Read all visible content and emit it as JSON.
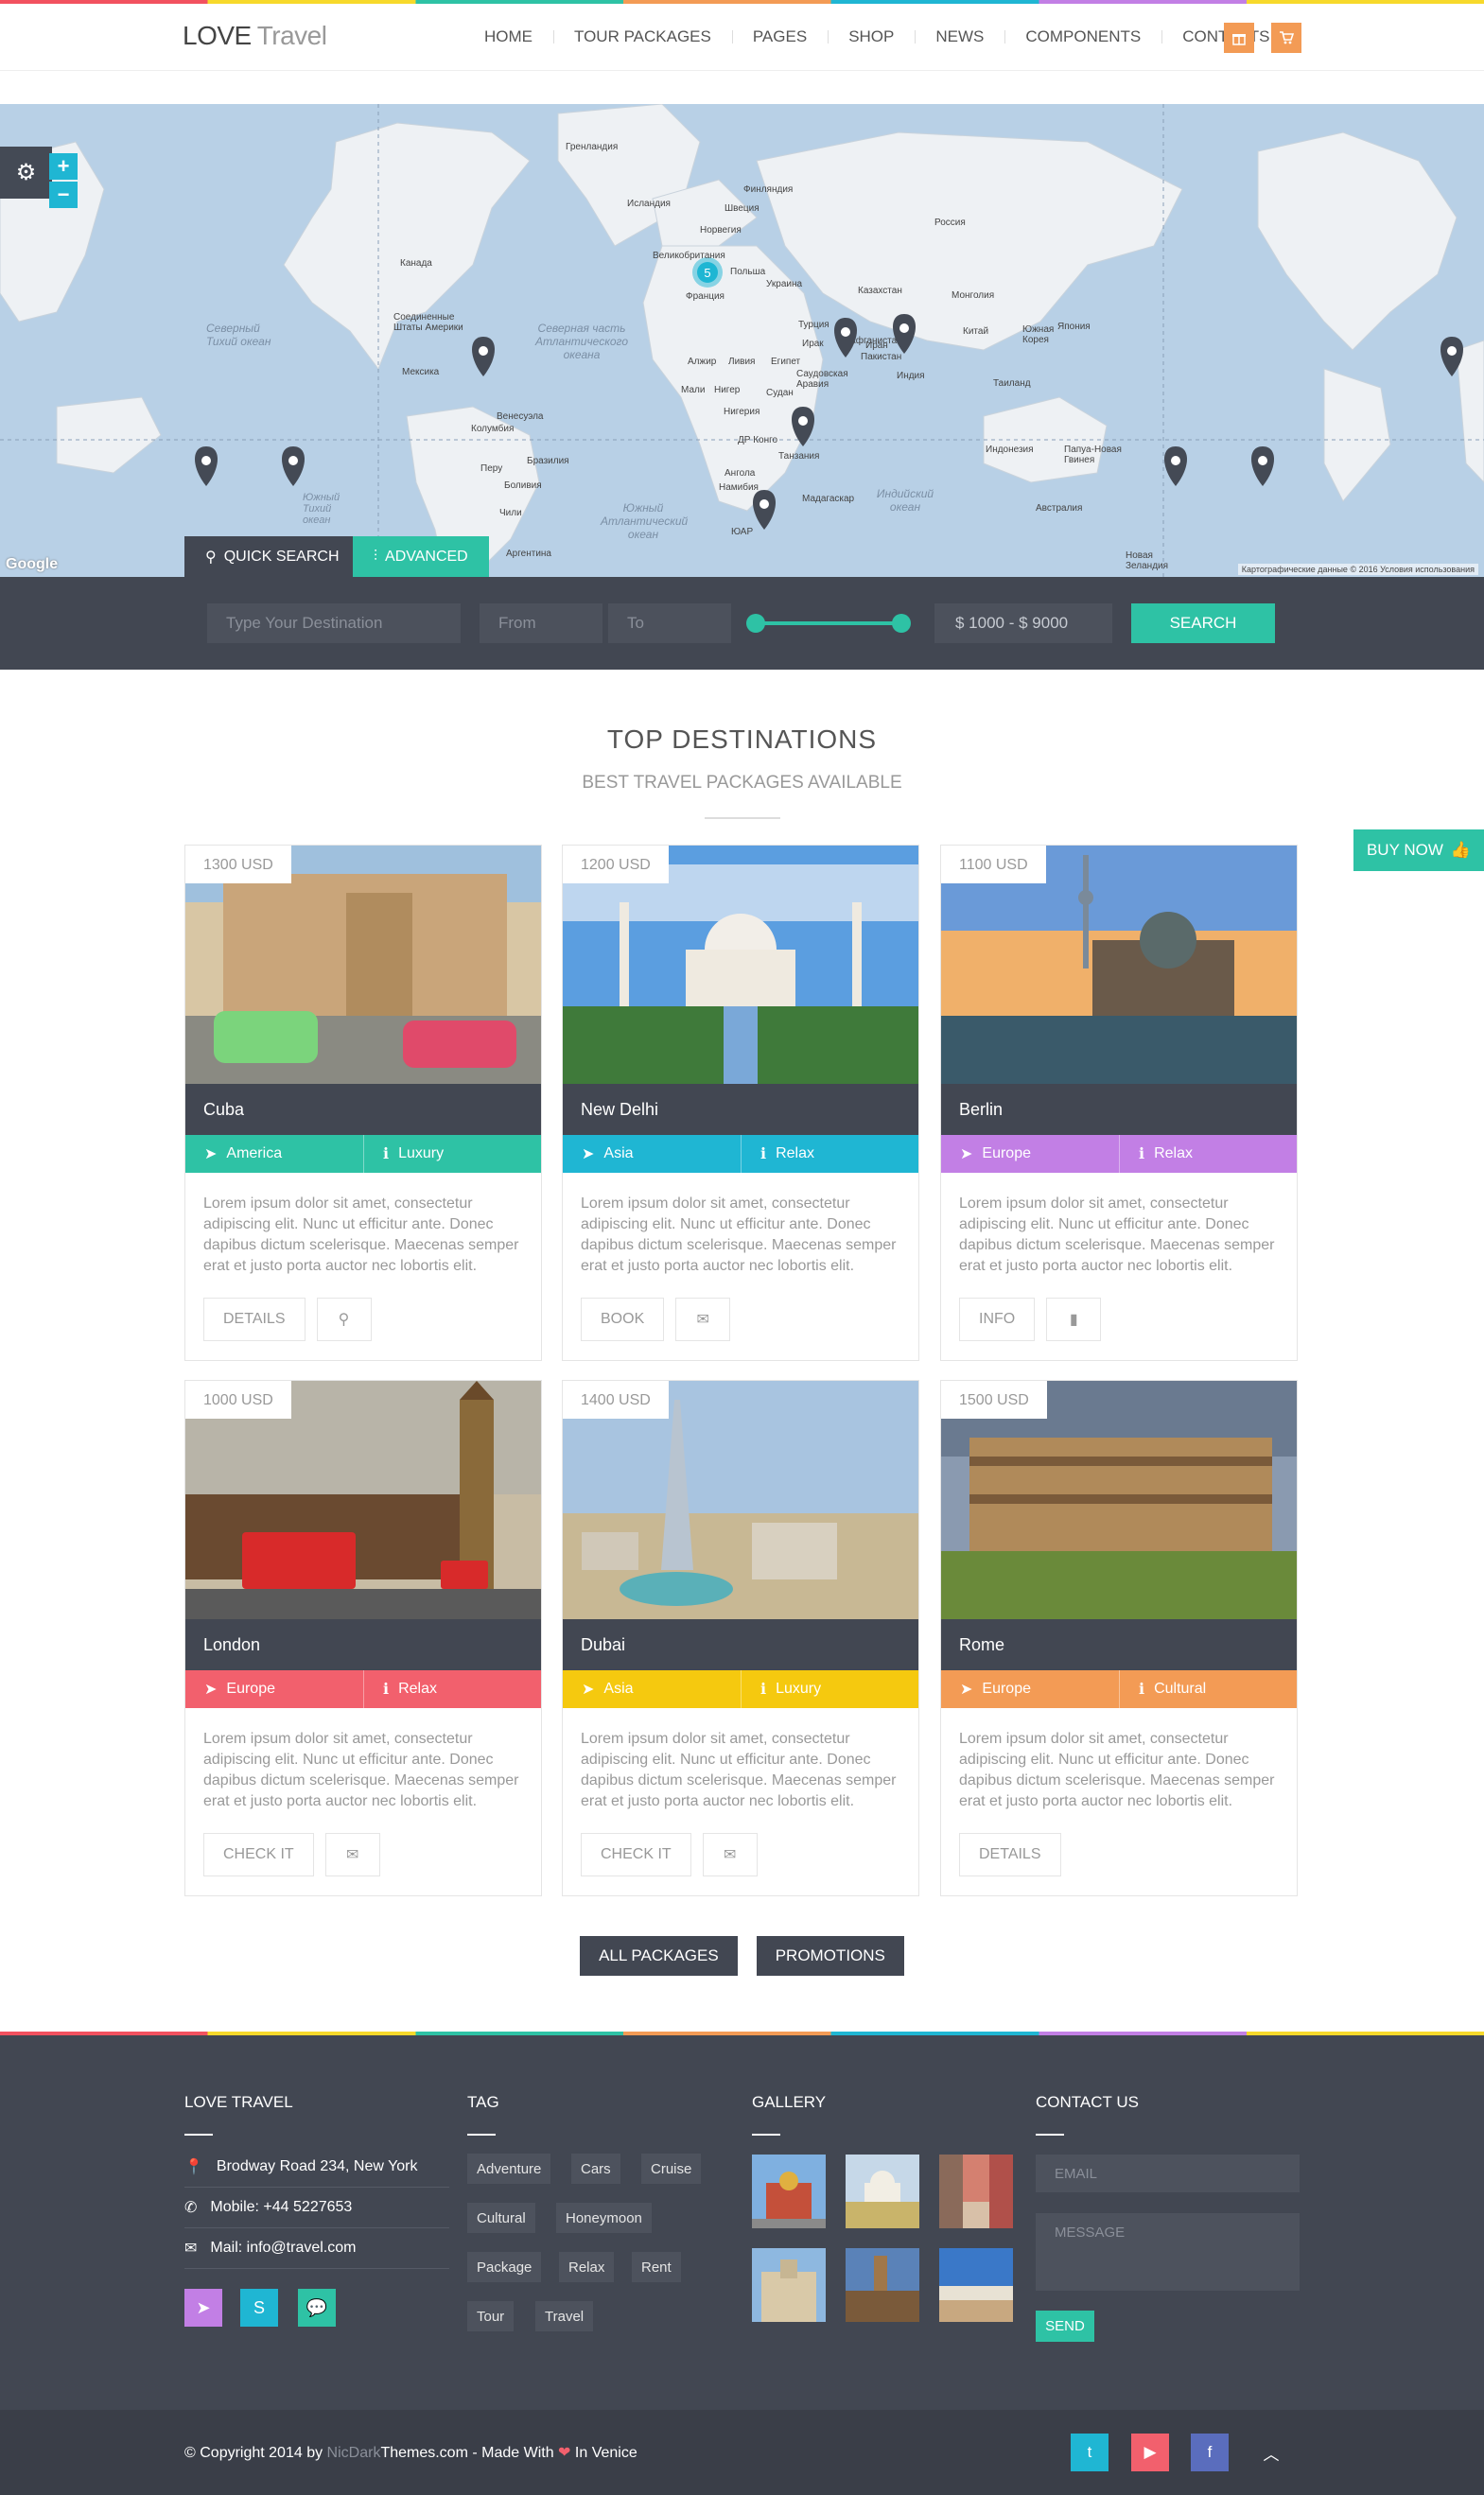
{
  "header": {
    "logo_bold": "LOVE",
    "logo_light": "Travel",
    "nav": [
      "HOME",
      "TOUR PACKAGES",
      "PAGES",
      "SHOP",
      "NEWS",
      "COMPONENTS",
      "CONTACTS"
    ],
    "icons": [
      "gift-icon",
      "cart-icon"
    ]
  },
  "map": {
    "zoom_in": "+",
    "zoom_out": "−",
    "cluster_count": "5",
    "google": "Google",
    "copyright": "Картографические данные © 2016   Условия использования",
    "labels": [
      "Гренландия",
      "Исландия",
      "Швеция",
      "Финляндия",
      "Норвегия",
      "Россия",
      "Великобритания",
      "Польша",
      "Украина",
      "Франция",
      "Казахстан",
      "Монголия",
      "Канада",
      "Соединенные Штаты Америки",
      "Мексика",
      "Венесуэла",
      "Колумбия",
      "Перу",
      "Бразилия",
      "Боливия",
      "Чили",
      "Аргентина",
      "Алжир",
      "Ливия",
      "Египет",
      "Мали",
      "Нигер",
      "Судан",
      "Нигерия",
      "ДР Конго",
      "Танзания",
      "Ангола",
      "Намибия",
      "ЮАР",
      "Мадагаскар",
      "Турция",
      "Ирак",
      "Иран",
      "Пакистан",
      "Индия",
      "Китай",
      "Япония",
      "Таиланд",
      "Индонезия",
      "Австралия",
      "Папуа-Новая Гвинея",
      "Новая Зеландия",
      "Северный Тихий океан",
      "Южный Тихий океан",
      "Северная часть Атлантического океана",
      "Южный Атлантический океан",
      "Индийский океан",
      "Саудовская Аравия",
      "Афганистан",
      "Южная Корея"
    ]
  },
  "search": {
    "tab_quick": "QUICK SEARCH",
    "tab_advanced": "ADVANCED",
    "destination_placeholder": "Type Your Destination",
    "from_placeholder": "From",
    "to_placeholder": "To",
    "price_range": "$ 1000 - $ 9000",
    "button": "SEARCH"
  },
  "section": {
    "title": "TOP DESTINATIONS",
    "subtitle": "BEST TRAVEL PACKAGES AVAILABLE"
  },
  "buy_now": "BUY NOW",
  "cards": [
    {
      "price": "1300 USD",
      "name": "Cuba",
      "tag1": "America",
      "tag2": "Luxury",
      "color": "#2ec2a5",
      "desc": "Lorem ipsum dolor sit amet, consectetur adipiscing elit. Nunc ut efficitur ante. Donec dapibus dictum scelerisque. Maecenas semper erat et justo porta auctor nec lobortis elit.",
      "btn": "DETAILS",
      "icon": "map-marker-icon"
    },
    {
      "price": "1200 USD",
      "name": "New Delhi",
      "tag1": "Asia",
      "tag2": "Relax",
      "color": "#1fb6d3",
      "desc": "Lorem ipsum dolor sit amet, consectetur adipiscing elit. Nunc ut efficitur ante. Donec dapibus dictum scelerisque. Maecenas semper erat et justo porta auctor nec lobortis elit.",
      "btn": "BOOK",
      "icon": "envelope-icon"
    },
    {
      "price": "1100 USD",
      "name": "Berlin",
      "tag1": "Europe",
      "tag2": "Relax",
      "color": "#c27fe5",
      "desc": "Lorem ipsum dolor sit amet, consectetur adipiscing elit. Nunc ut efficitur ante. Donec dapibus dictum scelerisque. Maecenas semper erat et justo porta auctor nec lobortis elit.",
      "btn": "INFO",
      "icon": "film-icon"
    },
    {
      "price": "1000 USD",
      "name": "London",
      "tag1": "Europe",
      "tag2": "Relax",
      "color": "#f2606d",
      "desc": "Lorem ipsum dolor sit amet, consectetur adipiscing elit. Nunc ut efficitur ante. Donec dapibus dictum scelerisque. Maecenas semper erat et justo porta auctor nec lobortis elit.",
      "btn": "CHECK IT",
      "icon": "envelope-icon"
    },
    {
      "price": "1400 USD",
      "name": "Dubai",
      "tag1": "Asia",
      "tag2": "Luxury",
      "color": "#f5c90f",
      "desc": "Lorem ipsum dolor sit amet, consectetur adipiscing elit. Nunc ut efficitur ante. Donec dapibus dictum scelerisque. Maecenas semper erat et justo porta auctor nec lobortis elit.",
      "btn": "CHECK IT",
      "icon": "envelope-icon"
    },
    {
      "price": "1500 USD",
      "name": "Rome",
      "tag1": "Europe",
      "tag2": "Cultural",
      "color": "#f39b55",
      "desc": "Lorem ipsum dolor sit amet, consectetur adipiscing elit. Nunc ut efficitur ante. Donec dapibus dictum scelerisque. Maecenas semper erat et justo porta auctor nec lobortis elit.",
      "btn": "DETAILS",
      "icon": ""
    }
  ],
  "more": {
    "all": "ALL PACKAGES",
    "promo": "PROMOTIONS"
  },
  "footer": {
    "col1_title": "LOVE TRAVEL",
    "address": "Brodway Road 234, New York",
    "mobile": "Mobile: +44 5227653",
    "mail": "Mail: info@travel.com",
    "col2_title": "TAG",
    "tags": [
      "Adventure",
      "Cars",
      "Cruise",
      "Cultural",
      "Honeymoon",
      "Package",
      "Relax",
      "Rent",
      "Tour",
      "Travel"
    ],
    "col3_title": "GALLERY",
    "col4_title": "CONTACT US",
    "email_placeholder": "EMAIL",
    "message_placeholder": "MESSAGE",
    "send": "SEND"
  },
  "bottom": {
    "copy_pre": "© Copyright 2014 by ",
    "copy_hl": "NicDark",
    "copy_mid": "Themes.com - Made With ",
    "heart": "❤",
    "copy_post": " In Venice"
  },
  "colors": {
    "accent": "#2ec2a5",
    "dark": "#424752",
    "orange": "#f39b55",
    "blue": "#1fb6d3",
    "purple": "#c27fe5",
    "red": "#f2606d",
    "yellow": "#f5c90f"
  }
}
